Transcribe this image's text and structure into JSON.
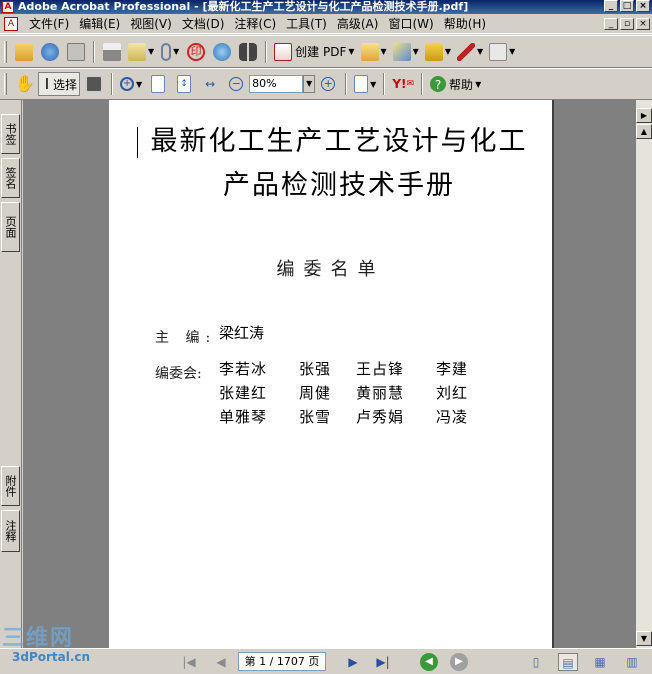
{
  "window": {
    "title": "Adobe Acrobat Professional - [最新化工生产工艺设计与化工产品检测技术手册.pdf]",
    "controls": [
      "_",
      "□",
      "×"
    ]
  },
  "menubar": {
    "items": [
      "文件(F)",
      "编辑(E)",
      "视图(V)",
      "文档(D)",
      "注释(C)",
      "工具(T)",
      "高级(A)",
      "窗口(W)",
      "帮助(H)"
    ],
    "doc_controls": [
      "_",
      "▫",
      "×"
    ]
  },
  "toolbar1": {
    "create_pdf_label": "创建 PDF",
    "icons": [
      "open-icon",
      "save-web-icon",
      "save-icon",
      "print-icon",
      "email-icon",
      "attach-icon",
      "stamp-icon",
      "email-send-icon",
      "search-binoculars-icon",
      "create-pdf-icon",
      "review-icon",
      "sign-icon",
      "secure-icon",
      "pen-icon",
      "forms-icon"
    ]
  },
  "toolbar2": {
    "select_label": "选择",
    "zoom_value": "80%",
    "help_label": "帮助",
    "yahoo_label": "Y!"
  },
  "leftnav": {
    "tabs": [
      "书签",
      "签名",
      "页面",
      "附件",
      "注释"
    ]
  },
  "document": {
    "title_line1": "最新化工生产工艺设计与化工",
    "title_line2": "产品检测技术手册",
    "subtitle": "编委名单",
    "chief_label": "主  编:",
    "chief_value": "梁红涛",
    "members_label": "编委会:",
    "members": [
      [
        "李若冰",
        "张强",
        "王占锋",
        "李建"
      ],
      [
        "张建红",
        "周健",
        "黄丽慧",
        "刘红"
      ],
      [
        "单雅琴",
        "张雪",
        "卢秀娟",
        "冯凌"
      ]
    ]
  },
  "statusbar": {
    "page_indicator": "第 1 / 1707 页"
  },
  "watermark": {
    "line1": "三维网",
    "line2": "3dPortal.cn"
  },
  "colors": {
    "titlebar": "#0a246a",
    "chrome": "#d4d0c8",
    "doc_background": "#808080"
  }
}
